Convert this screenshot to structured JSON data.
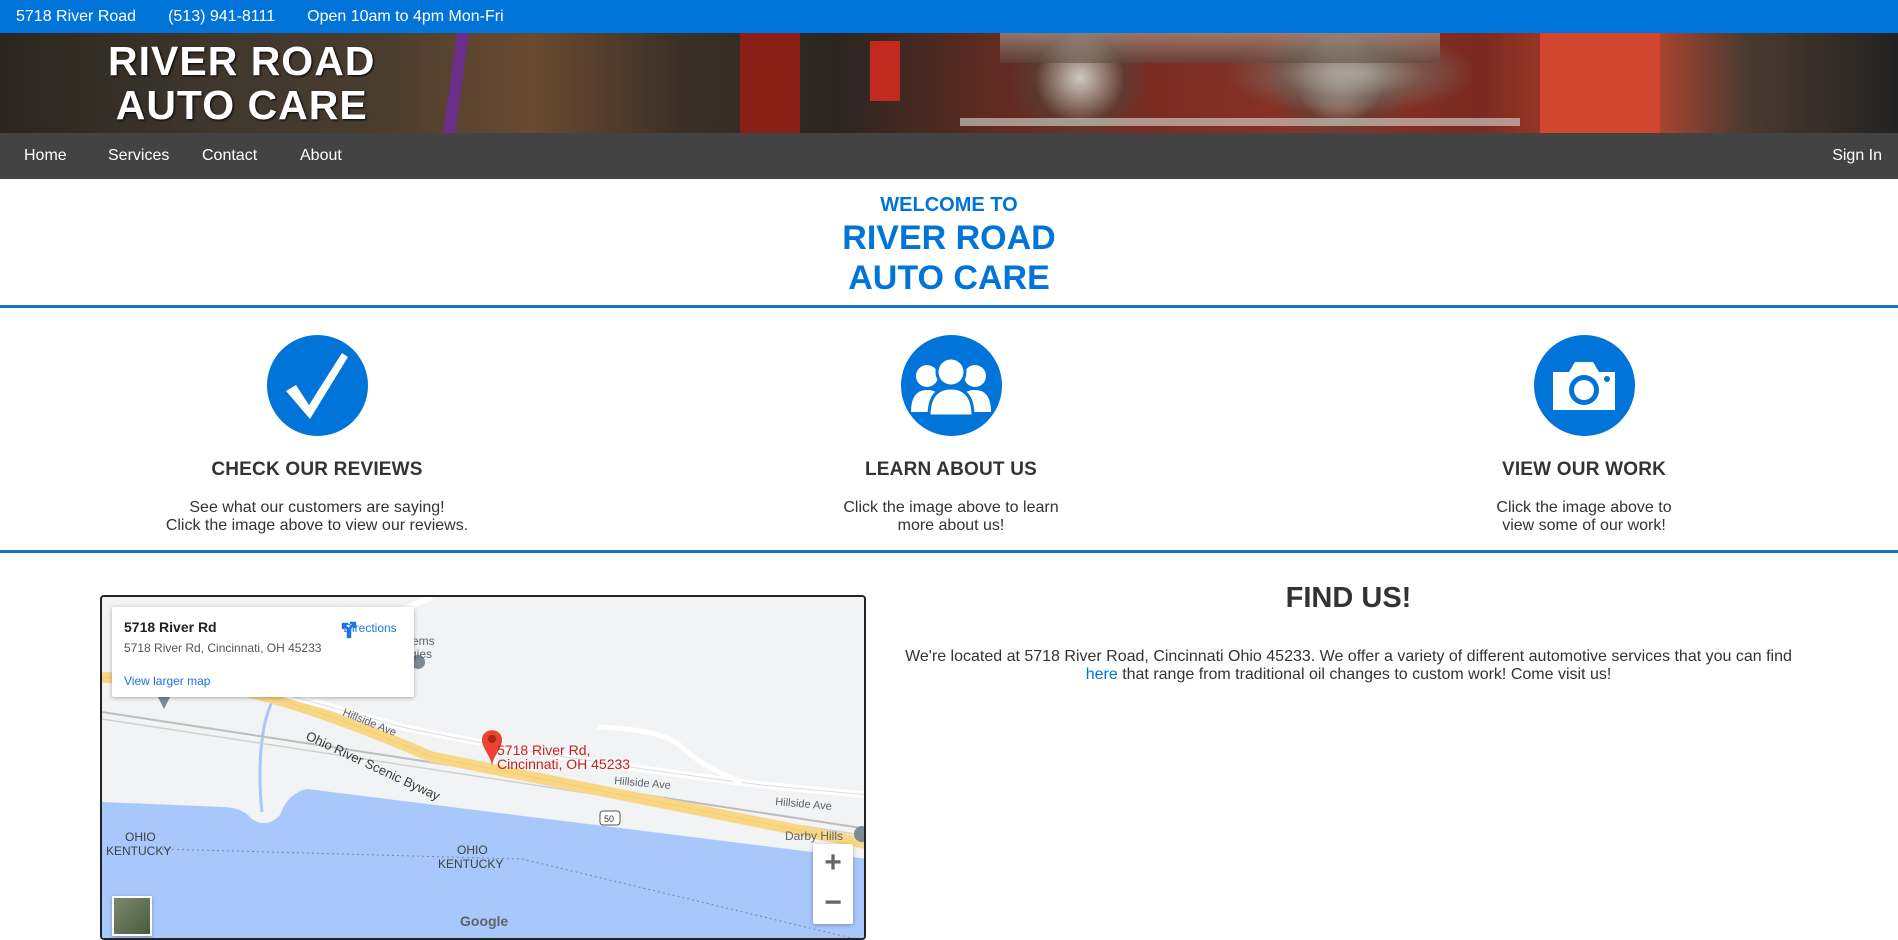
{
  "topbar": {
    "address": "5718 River Road",
    "phone": "(513) 941-8111",
    "hours": "Open 10am to 4pm Mon-Fri"
  },
  "banner": {
    "title_line1": "RIVER ROAD",
    "title_line2": "AUTO CARE"
  },
  "nav": {
    "items": [
      {
        "label": "Home"
      },
      {
        "label": "Services"
      },
      {
        "label": "Contact"
      },
      {
        "label": "About"
      }
    ],
    "signin": "Sign In"
  },
  "welcome": {
    "line1": "WELCOME TO",
    "line2": "RIVER ROAD",
    "line3": "AUTO CARE"
  },
  "features": [
    {
      "icon": "checkmark-icon",
      "title": "CHECK OUR REVIEWS",
      "line1": "See what our customers are saying!",
      "line2": "Click the image above to view our reviews."
    },
    {
      "icon": "people-icon",
      "title": "LEARN ABOUT US",
      "line1": "Click the image above to learn",
      "line2": "more about us!"
    },
    {
      "icon": "camera-icon",
      "title": "VIEW OUR WORK",
      "line1": "Click the image above to",
      "line2": "view some of our work!"
    }
  ],
  "map": {
    "place_name": "5718 River Rd",
    "place_address": "5718 River Rd, Cincinnati, OH 45233",
    "directions": "Directions",
    "view_larger": "View larger map",
    "pin_label_line1": "5718 River Rd,",
    "pin_label_line2": "Cincinnati, OH 45233",
    "road_byway": "Ohio River Scenic Byway",
    "road_hillside1": "Hillside Ave",
    "road_hillside2": "Hillside Ave",
    "road_hillside3": "Hillside Ave",
    "route_shield": "50",
    "area_darby": "Darby Hills",
    "label_ohio1": "OHIO",
    "label_kentucky1": "KENTUCKY",
    "label_ohio2": "OHIO",
    "label_kentucky2": "KENTUCKY",
    "label_ems": "ems",
    "label_gies": "gies",
    "zoom_in": "+",
    "zoom_out": "−",
    "google": "Google"
  },
  "find": {
    "title": "FIND US!",
    "text_before": "We're located at 5718 River Road, Cincinnati Ohio 45233. We offer a variety of different automotive services that you can find",
    "link": "here",
    "text_after": "that range from traditional oil changes to custom work! Come visit us!"
  },
  "colors": {
    "accent": "#0074d9",
    "nav_bg": "#434343",
    "rule": "#1b6fc6"
  }
}
